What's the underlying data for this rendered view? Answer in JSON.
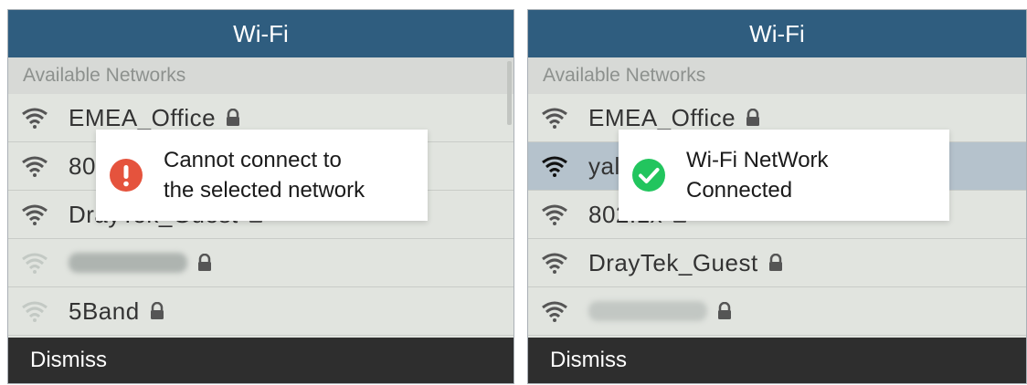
{
  "left_screen": {
    "title": "Wi-Fi",
    "section_label": "Available Networks",
    "networks": [
      {
        "ssid": "EMEA_Office",
        "locked": true
      },
      {
        "ssid": "80",
        "locked": false
      },
      {
        "ssid": "DrayTek_Guest",
        "locked": true
      },
      {
        "ssid": "",
        "locked": true,
        "redacted": true
      },
      {
        "ssid": "5Band",
        "locked": true
      }
    ],
    "toast": {
      "line1": "Cannot connect to",
      "line2": "the selected network",
      "icon": "error-icon",
      "icon_color": "#e5533d"
    },
    "footer_button": "Dismiss"
  },
  "right_screen": {
    "title": "Wi-Fi",
    "section_label": "Available Networks",
    "networks": [
      {
        "ssid": "EMEA_Office",
        "locked": true
      },
      {
        "ssid": "yal",
        "locked": false,
        "selected": true
      },
      {
        "ssid": "802.1x",
        "locked": true
      },
      {
        "ssid": "DrayTek_Guest",
        "locked": true
      },
      {
        "ssid": "",
        "locked": true,
        "redacted": true
      }
    ],
    "toast": {
      "line1": "Wi-Fi NetWork",
      "line2": "Connected",
      "icon": "success-check-icon",
      "icon_color": "#22c55e"
    },
    "footer_button": "Dismiss"
  }
}
